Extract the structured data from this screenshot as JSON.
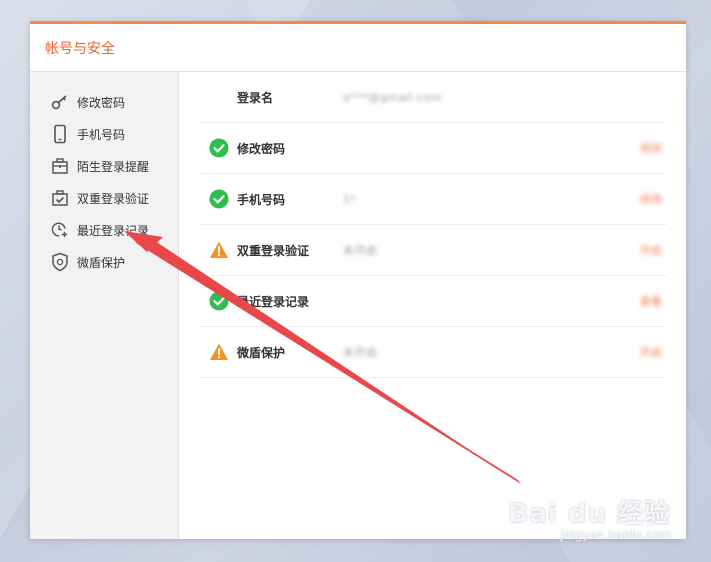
{
  "window": {
    "title": "帐号与安全"
  },
  "sidebar": {
    "items": [
      {
        "label": "修改密码",
        "icon": "key-icon"
      },
      {
        "label": "手机号码",
        "icon": "phone-icon"
      },
      {
        "label": "陌生登录提醒",
        "icon": "briefcase-alert-icon"
      },
      {
        "label": "双重登录验证",
        "icon": "briefcase-check-icon"
      },
      {
        "label": "最近登录记录",
        "icon": "clock-plus-icon"
      },
      {
        "label": "微盾保护",
        "icon": "shield-icon"
      }
    ]
  },
  "main": {
    "rows": [
      {
        "label": "登录名",
        "status": "none",
        "value": "a***@gmail.com",
        "action": ""
      },
      {
        "label": "修改密码",
        "status": "ok",
        "value": "",
        "action": "修改"
      },
      {
        "label": "手机号码",
        "status": "ok",
        "value": "1*",
        "action": "修改"
      },
      {
        "label": "双重登录验证",
        "status": "warning",
        "value": "未开启",
        "action": "开启"
      },
      {
        "label": "最近登录记录",
        "status": "ok",
        "value": "",
        "action": "查看"
      },
      {
        "label": "微盾保护",
        "status": "warning",
        "value": "未开启",
        "action": "开启"
      }
    ]
  },
  "colors": {
    "accent": "#e8642c",
    "ok": "#2dbe4e",
    "warning": "#f5931e",
    "arrow": "#e8484a"
  },
  "watermark": {
    "brand": "Bai du 经验",
    "url": "jingyan.baidu.com"
  }
}
